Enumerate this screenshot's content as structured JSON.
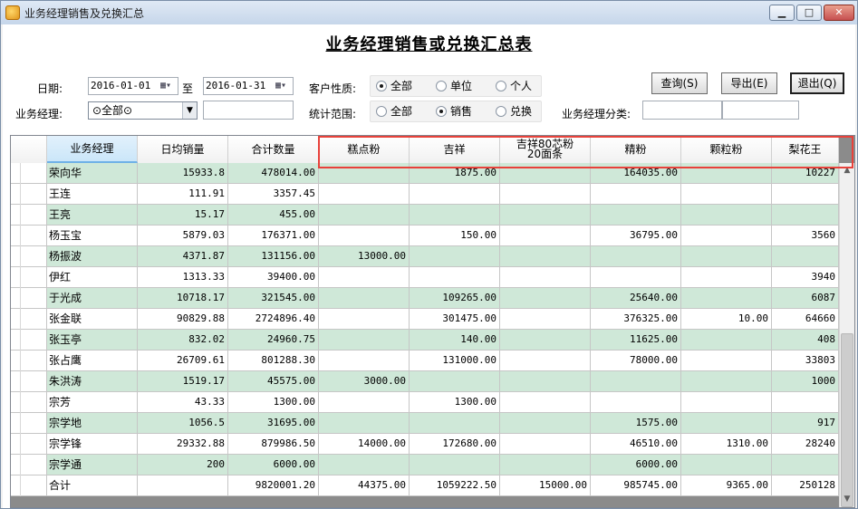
{
  "window": {
    "title": "业务经理销售及兑换汇总",
    "min": "▁",
    "max": "□",
    "close": "✕"
  },
  "report_title": "业务经理销售或兑换汇总表",
  "filters": {
    "date_label": "日期:",
    "date_from": "2016-01-01",
    "to_label": "至",
    "date_to": "2016-01-31",
    "calendar_icon": "▦▾",
    "customer_type_label": "客户性质:",
    "customer_type_options": [
      "全部",
      "单位",
      "个人"
    ],
    "customer_type_selected": 0,
    "manager_label": "业务经理:",
    "manager_value": "⊙全部⊙",
    "scope_label": "统计范围:",
    "scope_options": [
      "全部",
      "销售",
      "兑换"
    ],
    "scope_selected": 1,
    "category_label": "业务经理分类:"
  },
  "buttons": {
    "query": "查询(S)",
    "export": "导出(E)",
    "exit": "退出(Q)"
  },
  "columns": [
    "业务经理",
    "日均销量",
    "合计数量",
    "糕点粉",
    "吉祥",
    "吉祥80芯粉",
    "20面条",
    "精粉",
    "颗粒粉",
    "梨花王"
  ],
  "rows": [
    [
      "荣向华",
      "15933.8",
      "478014.00",
      "",
      "1875.00",
      "",
      "164035.00",
      "",
      "10227"
    ],
    [
      "王连",
      "111.91",
      "3357.45",
      "",
      "",
      "",
      "",
      "",
      ""
    ],
    [
      "王亮",
      "15.17",
      "455.00",
      "",
      "",
      "",
      "",
      "",
      ""
    ],
    [
      "杨玉宝",
      "5879.03",
      "176371.00",
      "",
      "150.00",
      "",
      "36795.00",
      "",
      "3560"
    ],
    [
      "杨振波",
      "4371.87",
      "131156.00",
      "13000.00",
      "",
      "",
      "",
      "",
      ""
    ],
    [
      "伊红",
      "1313.33",
      "39400.00",
      "",
      "",
      "",
      "",
      "",
      "3940"
    ],
    [
      "于光成",
      "10718.17",
      "321545.00",
      "",
      "109265.00",
      "",
      "25640.00",
      "",
      "6087"
    ],
    [
      "张金联",
      "90829.88",
      "2724896.40",
      "",
      "301475.00",
      "",
      "376325.00",
      "10.00",
      "64660"
    ],
    [
      "张玉亭",
      "832.02",
      "24960.75",
      "",
      "140.00",
      "",
      "11625.00",
      "",
      "408"
    ],
    [
      "张占鹰",
      "26709.61",
      "801288.30",
      "",
      "131000.00",
      "",
      "78000.00",
      "",
      "33803"
    ],
    [
      "朱洪涛",
      "1519.17",
      "45575.00",
      "3000.00",
      "",
      "",
      "",
      "",
      "1000"
    ],
    [
      "宗芳",
      "43.33",
      "1300.00",
      "",
      "1300.00",
      "",
      "",
      "",
      ""
    ],
    [
      "宗学地",
      "1056.5",
      "31695.00",
      "",
      "",
      "",
      "1575.00",
      "",
      "917"
    ],
    [
      "宗学锋",
      "29332.88",
      "879986.50",
      "14000.00",
      "172680.00",
      "",
      "46510.00",
      "1310.00",
      "28240"
    ],
    [
      "宗学通",
      "200",
      "6000.00",
      "",
      "",
      "",
      "6000.00",
      "",
      ""
    ],
    [
      "合计",
      "",
      "9820001.20",
      "44375.00",
      "1059222.50",
      "15000.00",
      "985745.00",
      "9365.00",
      "250128"
    ]
  ],
  "colors": {
    "alt_row": "#cfe8d8",
    "highlight": "#e8423b"
  }
}
